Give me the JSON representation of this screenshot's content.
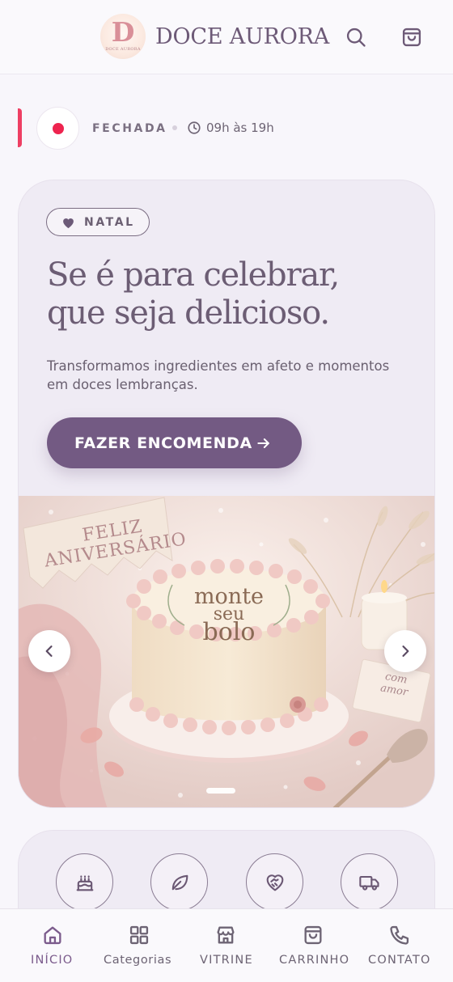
{
  "header": {
    "logo_monogram": "D",
    "logo_small_text": "DOCE AURORA",
    "brand_name": "DOCE AURORA",
    "search_icon": "search-icon",
    "cart_icon": "shopping-bag-icon"
  },
  "status": {
    "state": "FECHADA",
    "hours": "09h às 19h",
    "state_color": "#ee244f"
  },
  "hero": {
    "tag_label": "NATAL",
    "headline_line1": "Se é para celebrar,",
    "headline_line2": "que seja delicioso.",
    "subtext": "Transformamos ingredientes em afeto e momentos em doces lembranças.",
    "cta_label": "FAZER ENCOMENDA",
    "accent_color": "#735a83"
  },
  "carousel": {
    "banner_text_line1": "FELIZ",
    "banner_text_line2": "ANIVERSÁRIO",
    "cake_text_line1": "monte",
    "cake_text_line2": "seu",
    "cake_text_line3": "bolo",
    "note_line1": "com",
    "note_line2": "amor",
    "prev_icon": "chevron-left-icon",
    "next_icon": "chevron-right-icon"
  },
  "features": [
    {
      "icon": "cake-icon"
    },
    {
      "icon": "leaf-icon"
    },
    {
      "icon": "heart-handshake-icon"
    },
    {
      "icon": "truck-icon"
    }
  ],
  "bottom_nav": [
    {
      "label": "INÍCIO",
      "icon": "home-icon",
      "active": true
    },
    {
      "label": "Categorias",
      "icon": "grid-icon",
      "active": false
    },
    {
      "label": "VITRINE",
      "icon": "store-icon",
      "active": false
    },
    {
      "label": "CARRINHO",
      "icon": "shopping-bag-icon",
      "active": false
    },
    {
      "label": "CONTATO",
      "icon": "phone-icon",
      "active": false
    }
  ]
}
